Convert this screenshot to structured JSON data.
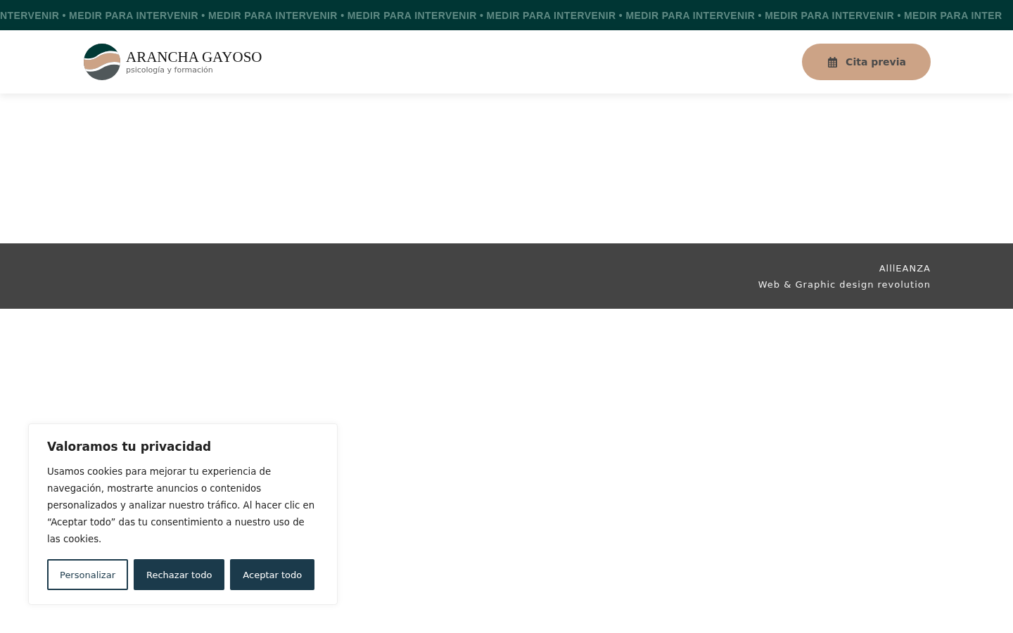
{
  "ticker": "NTERVENIR • MEDIR PARA INTERVENIR • MEDIR PARA INTERVENIR • MEDIR PARA INTERVENIR • MEDIR PARA INTERVENIR • MEDIR PARA INTERVENIR • MEDIR PARA INTERVENIR • MEDIR PARA INTER",
  "header": {
    "brand": "ARANCHA GAYOSO",
    "tagline": "psicología y formación",
    "cta": "Cita previa"
  },
  "footer": {
    "lines": [
      "AlllEANZA",
      "Web & Graphic design revolution"
    ]
  },
  "cookie_banner": {
    "title": "Valoramos tu privacidad",
    "text": "Usamos cookies para mejorar tu experiencia de navegación, mostrarte anuncios o contenidos personalizados y analizar nuestro tráfico. Al hacer clic en “Aceptar todo” das tu consentimiento a nuestro uso de las cookies.",
    "buttons": [
      {
        "label": "Personalizar",
        "kind": "outline"
      },
      {
        "label": "Rechazar todo",
        "kind": "filled"
      },
      {
        "label": "Aceptar todo",
        "kind": "filled"
      }
    ]
  }
}
